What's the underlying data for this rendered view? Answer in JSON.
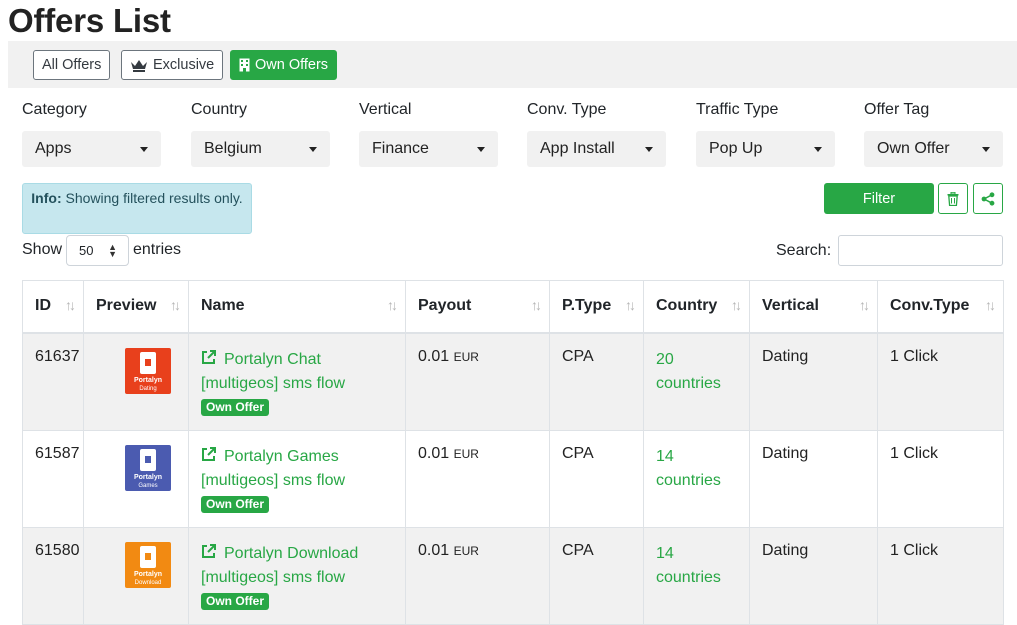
{
  "page": {
    "title": "Offers List"
  },
  "tabs": [
    {
      "label": "All Offers",
      "icon": "none",
      "active": false
    },
    {
      "label": "Exclusive",
      "icon": "crown-icon",
      "active": false
    },
    {
      "label": "Own Offers",
      "icon": "building-icon",
      "active": true
    }
  ],
  "filters": [
    {
      "label": "Category",
      "value": "Apps"
    },
    {
      "label": "Country",
      "value": "Belgium"
    },
    {
      "label": "Vertical",
      "value": "Finance"
    },
    {
      "label": "Conv. Type",
      "value": "App Install"
    },
    {
      "label": "Traffic Type",
      "value": "Pop Up"
    },
    {
      "label": "Offer Tag",
      "value": "Own Offer"
    }
  ],
  "info": {
    "title": "Info:",
    "text": "Showing filtered results only."
  },
  "actions": {
    "filter_label": "Filter",
    "delete_icon": "trash-icon",
    "share_icon": "share-icon"
  },
  "entries": {
    "show_label": "Show",
    "value": "50",
    "suffix": "entries"
  },
  "search": {
    "label": "Search:",
    "value": "",
    "placeholder": ""
  },
  "table": {
    "headers": [
      "ID",
      "Preview",
      "Name",
      "Payout",
      "P.Type",
      "Country",
      "Vertical",
      "Conv.Type"
    ],
    "rows": [
      {
        "id": "61637",
        "preview_brand": "Portalyn",
        "preview_sub": "Dating",
        "preview_color": "#e8401c",
        "name": "Portalyn Chat [multigeos] sms flow",
        "badge": "Own Offer",
        "payout": "0.01",
        "currency": "EUR",
        "ptype": "CPA",
        "country": "20 countries",
        "vertical": "Dating",
        "conv_type": "1 Click"
      },
      {
        "id": "61587",
        "preview_brand": "Portalyn",
        "preview_sub": "Games",
        "preview_color": "#4b5bb0",
        "name": "Portalyn Games [multigeos] sms flow",
        "badge": "Own Offer",
        "payout": "0.01",
        "currency": "EUR",
        "ptype": "CPA",
        "country": "14 countries",
        "vertical": "Dating",
        "conv_type": "1 Click"
      },
      {
        "id": "61580",
        "preview_brand": "Portalyn",
        "preview_sub": "Download",
        "preview_color": "#f28a12",
        "name": "Portalyn Download [multigeos] sms flow",
        "badge": "Own Offer",
        "payout": "0.01",
        "currency": "EUR",
        "ptype": "CPA",
        "country": "14 countries",
        "vertical": "Dating",
        "conv_type": "1 Click"
      }
    ]
  },
  "colors": {
    "accent": "#28a745",
    "info_bg": "#c6e7ee",
    "stripe": "#f1f1f1"
  }
}
